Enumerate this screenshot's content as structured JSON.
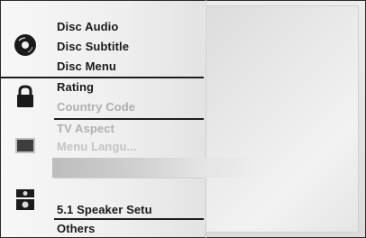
{
  "menu": {
    "disc_group": {
      "icon": "disc-icon",
      "items": [
        "Disc Audio",
        "Disc Subtitle",
        "Disc Menu"
      ]
    },
    "lock_group": {
      "icon": "lock-icon",
      "items": [
        "Rating",
        "Country Code"
      ]
    },
    "display_group": {
      "icon": "tv-icon",
      "items": [
        "TV Aspect",
        "Menu Langu..."
      ]
    },
    "speaker_group": {
      "icon": "speaker-icon",
      "items": [
        "5.1 Speaker Setu"
      ]
    },
    "others_label": "Others"
  }
}
